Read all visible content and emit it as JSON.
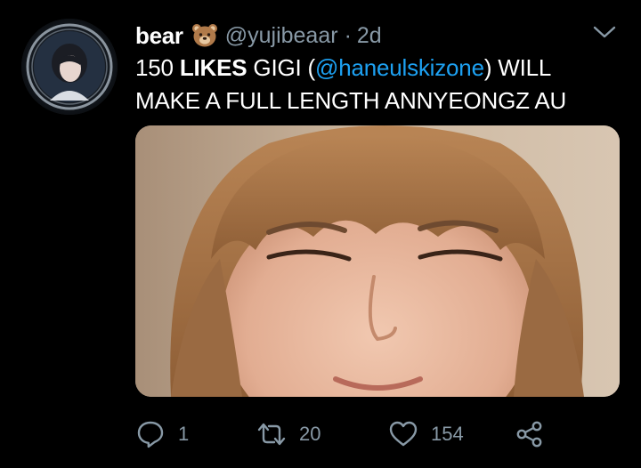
{
  "tweet": {
    "author": {
      "display_name": "bear",
      "emoji_icon": "bear-face-emoji",
      "handle": "@yujibeaar",
      "separator": "·",
      "time": "2d"
    },
    "text": {
      "part1": "150 ",
      "part2_bold": "LIKES",
      "part3": " GIGI (",
      "mention": "@haneulskizone",
      "part4": ") WILL MAKE A FULL LENGTH ANNYEONGZ AU"
    },
    "actions": {
      "reply_count": "1",
      "retweet_count": "20",
      "like_count": "154"
    }
  },
  "colors": {
    "background": "#000000",
    "text": "#ffffff",
    "secondary": "#8899a6",
    "link": "#1da1f2"
  },
  "icons": [
    "bear-face-emoji",
    "chevron-down-icon",
    "reply-icon",
    "retweet-icon",
    "like-icon",
    "share-icon"
  ]
}
